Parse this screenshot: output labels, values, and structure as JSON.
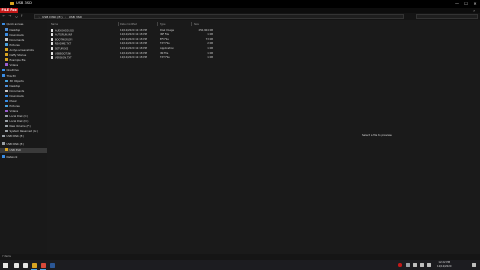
{
  "window": {
    "title": "USB 3SD",
    "controls": {
      "minimize": "—",
      "maximize": "☐",
      "close": "✕"
    }
  },
  "ribbon": {
    "file_tab": "FILE",
    "file_tab_suffix": "Foo",
    "help": "?"
  },
  "address": {
    "crumbs": [
      "USB DISK (E:)",
      "USB 3SD"
    ],
    "separator": "›",
    "back": "←",
    "forward": "→",
    "up": "↑"
  },
  "navpane": {
    "items": [
      {
        "label": "Quick access",
        "icon": "star-icon",
        "color": "#3a8ee6"
      },
      {
        "label": "Desktop",
        "icon": "folder-icon",
        "color": "#4f8fd8"
      },
      {
        "label": "Downloads",
        "icon": "download-icon",
        "color": "#3a8ee6"
      },
      {
        "label": "Documents",
        "icon": "document-icon",
        "color": "#c8c8c8"
      },
      {
        "label": "Pictures",
        "icon": "picture-icon",
        "color": "#4aa3e0"
      },
      {
        "label": "Andys screenshots",
        "icon": "folder-icon",
        "color": "#d9a521"
      },
      {
        "label": "Daffy Stories",
        "icon": "folder-icon",
        "color": "#d9a521"
      },
      {
        "label": "Example file",
        "icon": "folder-icon",
        "color": "#d9a521"
      },
      {
        "label": "Videos",
        "icon": "video-icon",
        "color": "#9b5fd0"
      },
      {
        "label": "OneDrive",
        "icon": "cloud-icon",
        "color": "#3a8ee6"
      },
      {
        "label": "This PC",
        "icon": "pc-icon",
        "color": "#3a8ee6"
      },
      {
        "label": "3D Objects",
        "icon": "cube-icon",
        "color": "#4aa3e0"
      },
      {
        "label": "Desktop",
        "icon": "folder-icon",
        "color": "#4f8fd8"
      },
      {
        "label": "Documents",
        "icon": "document-icon",
        "color": "#c8c8c8"
      },
      {
        "label": "Downloads",
        "icon": "download-icon",
        "color": "#3a8ee6"
      },
      {
        "label": "Music",
        "icon": "music-icon",
        "color": "#3a8ee6"
      },
      {
        "label": "Pictures",
        "icon": "picture-icon",
        "color": "#4aa3e0"
      },
      {
        "label": "Videos",
        "icon": "video-icon",
        "color": "#9b5fd0"
      },
      {
        "label": "Local Disk (C:)",
        "icon": "drive-icon",
        "color": "#9aa0a6"
      },
      {
        "label": "Local Disk (D:)",
        "icon": "drive-icon",
        "color": "#9aa0a6"
      },
      {
        "label": "New Volume (F:)",
        "icon": "drive-icon",
        "color": "#9aa0a6"
      },
      {
        "label": "System Reserved (G:)",
        "icon": "drive-icon",
        "color": "#9aa0a6"
      },
      {
        "label": "USB DISK (E:)",
        "icon": "usb-icon",
        "color": "#9aa0a6"
      },
      {
        "label": "USB DISK (E:)",
        "icon": "usb-icon",
        "color": "#9aa0a6"
      },
      {
        "label": "USB 3SD",
        "icon": "folder-icon",
        "color": "#d9a521"
      },
      {
        "label": "Network",
        "icon": "network-icon",
        "color": "#3a8ee6"
      }
    ]
  },
  "columns": [
    "Name",
    "Date modified",
    "Type",
    "Size"
  ],
  "files": [
    {
      "name": "AUDIOHDD.ISO",
      "date": "12/12/2020 12:18 PM",
      "type": "Disk Image",
      "size": "250,904 KB"
    },
    {
      "name": "AUTORUN.INF",
      "date": "12/12/2020 12:18 PM",
      "type": "INF File",
      "size": "1 KB"
    },
    {
      "name": "BOOTMGR.EFI",
      "date": "12/12/2020 12:18 PM",
      "type": "EFI File",
      "size": "73 KB"
    },
    {
      "name": "README.TXT",
      "date": "12/12/2020 12:18 PM",
      "type": "TXT File",
      "size": "2 KB"
    },
    {
      "name": "SETUP.EXE",
      "date": "12/12/2020 12:18 PM",
      "type": "Application",
      "size": "1 KB"
    },
    {
      "name": "USBBOOT.INI",
      "date": "12/12/2020 12:18 PM",
      "type": "INI File",
      "size": "1 KB"
    },
    {
      "name": "VERSION.TXT",
      "date": "12/12/2020 12:18 PM",
      "type": "TXT File",
      "size": "1 KB"
    }
  ],
  "preview": {
    "message": "Select a file to preview."
  },
  "status": {
    "text": "7 items"
  },
  "taskbar": {
    "apps": [
      {
        "name": "search",
        "color": "#e6e6e6"
      },
      {
        "name": "task-view",
        "color": "#e6e6e6"
      },
      {
        "name": "file-explorer",
        "color": "#d9a521"
      },
      {
        "name": "chrome",
        "color": "#d94a3a"
      },
      {
        "name": "word",
        "color": "#2b5797"
      }
    ],
    "clock": {
      "time": "12:22 PM",
      "date": "12/12/2020"
    }
  }
}
